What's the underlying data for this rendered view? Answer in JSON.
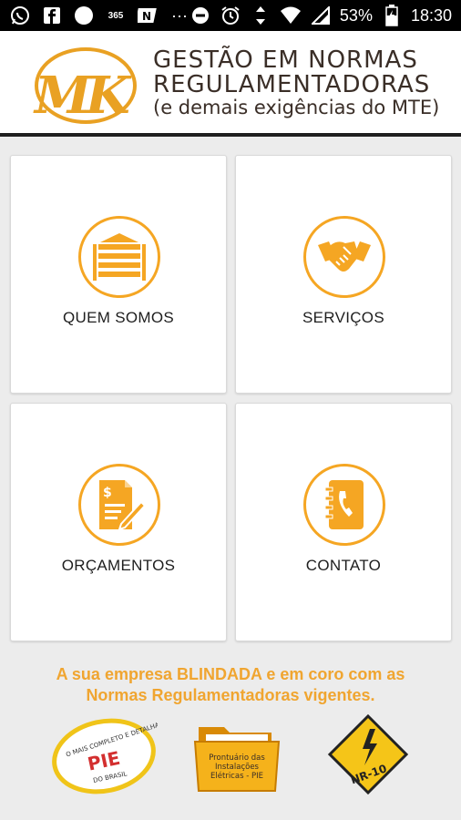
{
  "status_bar": {
    "battery_percent": "53%",
    "time": "18:30",
    "icons_left": [
      "whatsapp-icon",
      "facebook-icon",
      "circle-icon",
      "office365-icon",
      "nfc-icon",
      "more-icon"
    ],
    "icons_right": [
      "do-not-disturb-icon",
      "alarm-icon",
      "data-arrows-icon",
      "wifi-icon",
      "signal-icon",
      "battery-icon"
    ],
    "small_label": "365"
  },
  "header": {
    "logo_text": "MK",
    "title_line1": "GESTÃO EM NORMAS",
    "title_line2": "REGULAMENTADORAS",
    "title_line3": "(e demais exigências do MTE)"
  },
  "menu": {
    "about_label": "QUEM SOMOS",
    "services_label": "SERVIÇOS",
    "quotes_label": "ORÇAMENTOS",
    "contact_label": "CONTATO"
  },
  "tagline": {
    "line1": "A sua empresa BLINDADA e em coro com as",
    "line2": "Normas Regulamentadoras vigentes."
  },
  "badges": {
    "pie_top": "O MAIS COMPLETO E DETALHADO",
    "pie_main": "PIE",
    "pie_bottom": "DO BRASIL",
    "folder_line1": "Prontuário das",
    "folder_line2": "Instalações",
    "folder_line3": "Elétricas - PIE",
    "nr_label": "NR-10"
  },
  "colors": {
    "accent": "#f5a623",
    "tagline": "#f0a530",
    "title": "#3a2e27"
  }
}
